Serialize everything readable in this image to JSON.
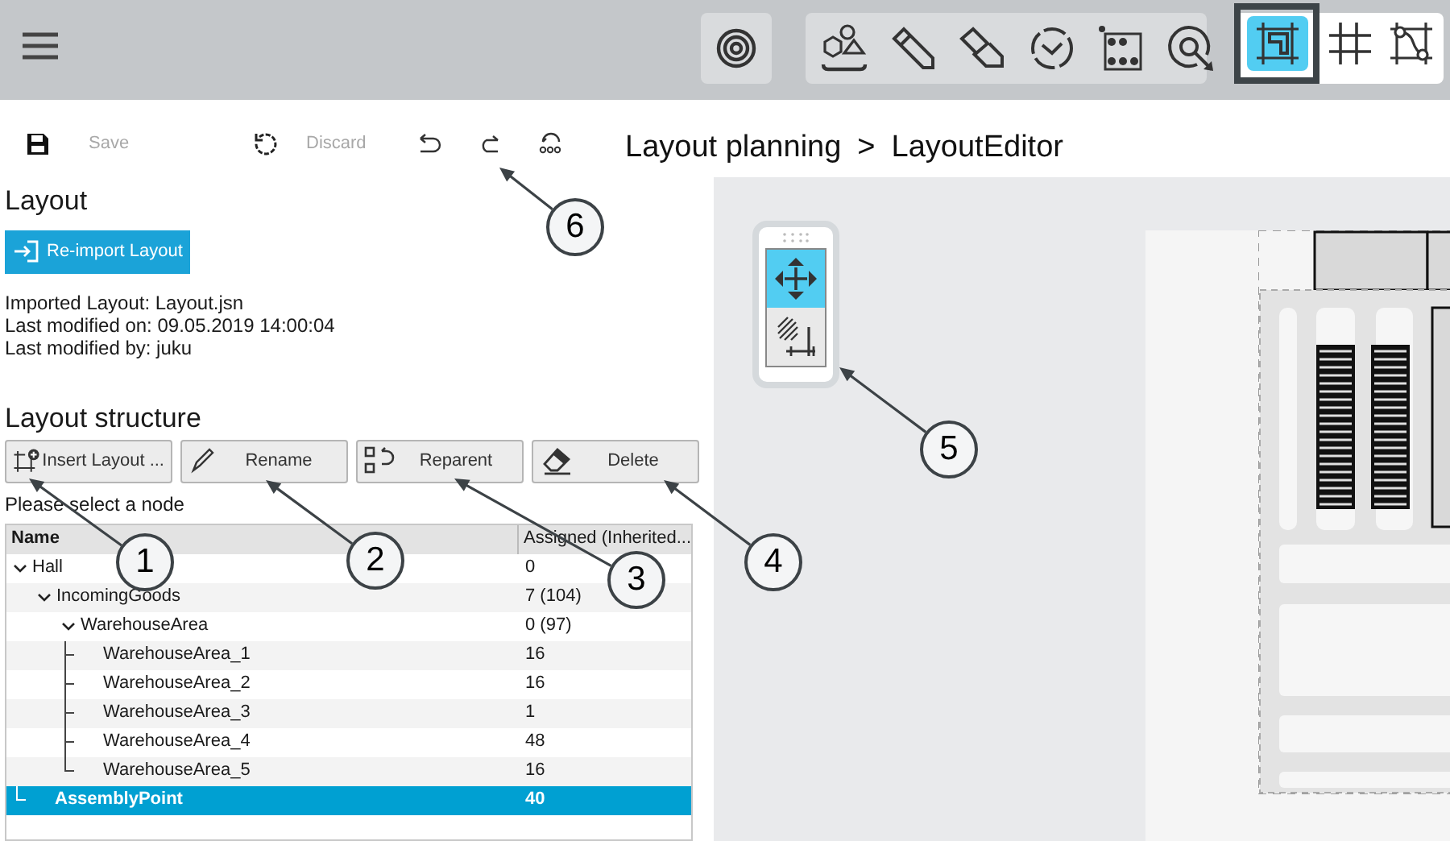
{
  "top_bar": {
    "view_modes": [
      {
        "selected": true
      },
      {
        "selected": false
      },
      {
        "selected": false
      }
    ]
  },
  "toolbar": {
    "save": {
      "label": "Save",
      "disabled": true
    },
    "discard": {
      "label": "Discard",
      "disabled": true
    }
  },
  "breadcrumb": {
    "items": [
      "Layout planning",
      "LayoutEditor"
    ],
    "separator": ">"
  },
  "layout": {
    "heading": "Layout",
    "reimport_button": "Re-import Layout",
    "info": [
      "Imported Layout: Layout.jsn",
      "Last modified on: 09.05.2019 14:00:04",
      "Last modified by: juku"
    ]
  },
  "structure": {
    "heading": "Layout structure",
    "buttons": [
      "Insert Layout ...",
      "Rename",
      "Reparent",
      "Delete"
    ],
    "hint": "Please select a node",
    "columns": [
      "Name",
      "Assigned (Inherited..."
    ],
    "tree": [
      {
        "name": "Hall",
        "assigned": "0",
        "expanded": true,
        "selected": false,
        "children": [
          {
            "name": "IncomingGoods",
            "assigned": "7 (104)",
            "expanded": true,
            "selected": false,
            "children": [
              {
                "name": "WarehouseArea",
                "assigned": "0 (97)",
                "expanded": true,
                "selected": false,
                "children": [
                  {
                    "name": "WarehouseArea_1",
                    "assigned": "16",
                    "selected": false
                  },
                  {
                    "name": "WarehouseArea_2",
                    "assigned": "16",
                    "selected": false
                  },
                  {
                    "name": "WarehouseArea_3",
                    "assigned": "1",
                    "selected": false
                  },
                  {
                    "name": "WarehouseArea_4",
                    "assigned": "48",
                    "selected": false
                  },
                  {
                    "name": "WarehouseArea_5",
                    "assigned": "16",
                    "selected": false
                  }
                ]
              }
            ]
          },
          {
            "name": "AssemblyPoint",
            "assigned": "40",
            "selected": true
          }
        ]
      }
    ]
  },
  "canvas": {
    "tools": [
      {
        "selected": true
      },
      {
        "selected": false
      }
    ]
  },
  "callouts": [
    "1",
    "2",
    "3",
    "4",
    "5",
    "6"
  ]
}
